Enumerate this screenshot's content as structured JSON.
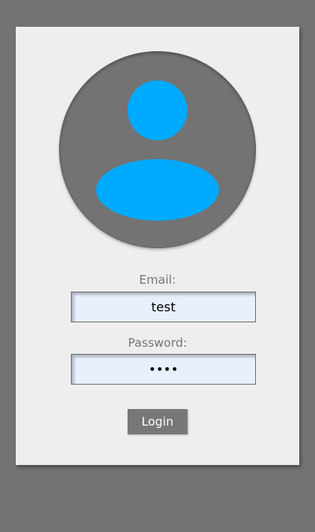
{
  "avatar": {
    "icon": "user-icon",
    "background_color": "#737373",
    "icon_color": "#00aaff"
  },
  "form": {
    "email_label": "Email:",
    "email_value": "test",
    "password_label": "Password:",
    "password_value": "test",
    "login_label": "Login"
  },
  "colors": {
    "page_background": "#737373",
    "card_background": "#eeeeee",
    "input_background": "#e8f0fe",
    "button_background": "#777777"
  }
}
